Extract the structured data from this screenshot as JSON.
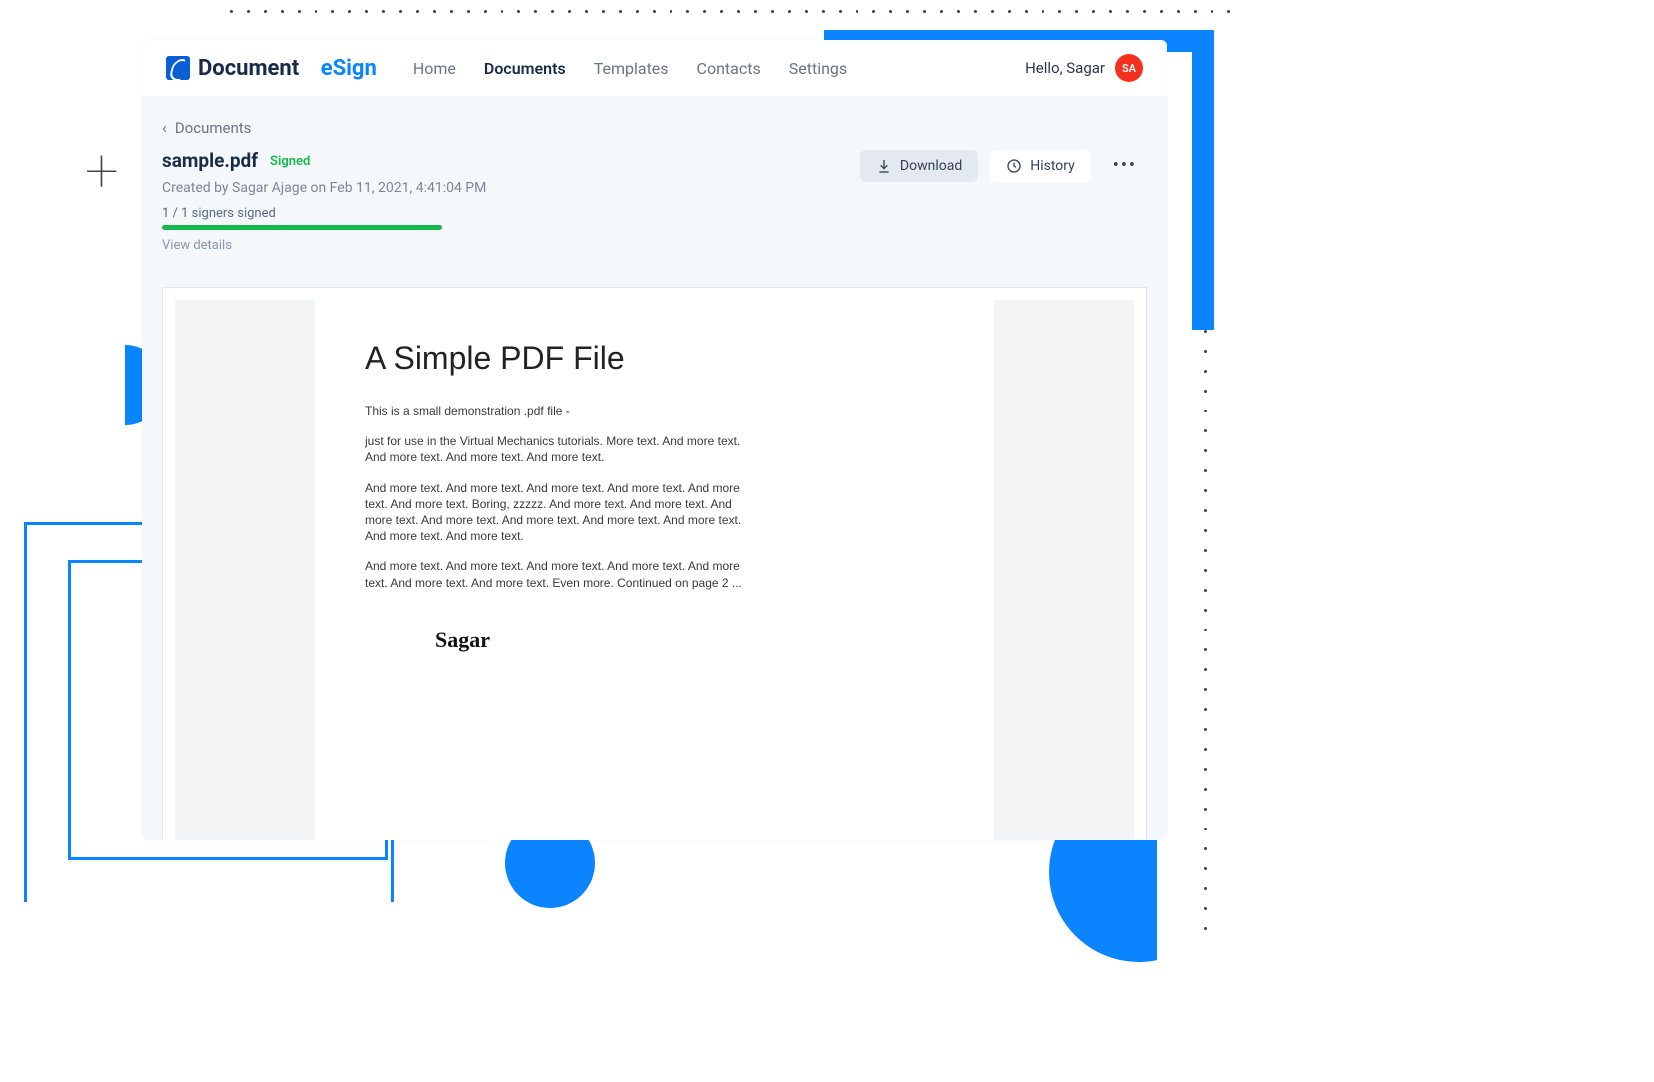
{
  "brand": {
    "name": "Document",
    "accent": "eSign"
  },
  "nav": {
    "items": [
      "Home",
      "Documents",
      "Templates",
      "Contacts",
      "Settings"
    ],
    "active_index": 1
  },
  "user": {
    "greeting": "Hello, Sagar",
    "initials": "SA"
  },
  "breadcrumb": {
    "label": "Documents"
  },
  "doc": {
    "filename": "sample.pdf",
    "status": "Signed",
    "created": "Created by Sagar Ajage on Feb 11, 2021, 4:41:04 PM",
    "signers_line": "1 / 1 signers signed",
    "view_details": "View details"
  },
  "actions": {
    "download": "Download",
    "history": "History"
  },
  "pdf": {
    "title": "A Simple PDF File",
    "p1": "This is a small demonstration .pdf file -",
    "p2": "just for use in the Virtual Mechanics tutorials. More text. And more text. And more text. And more text. And more text.",
    "p3": "And more text. And more text. And more text. And more text. And more text. And more text. Boring, zzzzz. And more text. And more text. And more text. And more text. And more text. And more text. And more text. And more text. And more text.",
    "p4": "And more text. And more text. And more text. And more text. And more text. And more text. And more text. Even more. Continued on page 2 ...",
    "signature": "Sagar"
  }
}
